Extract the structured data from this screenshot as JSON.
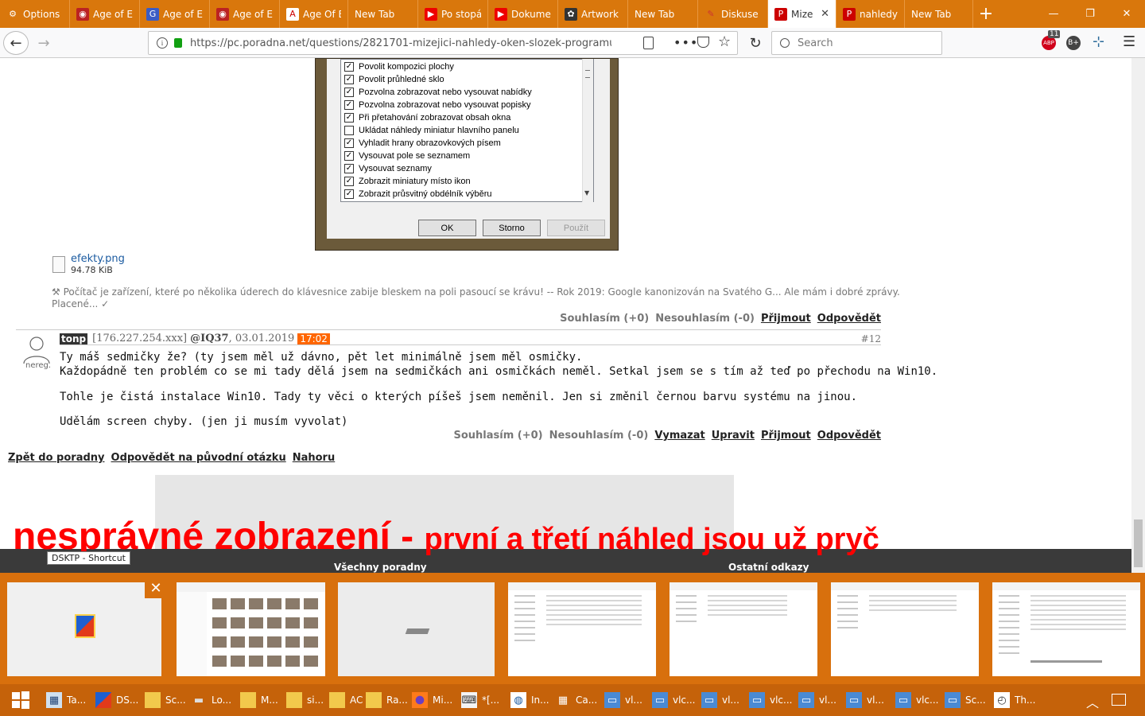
{
  "tabs": [
    {
      "label": "Options",
      "icon": "gear-icon",
      "active": false
    },
    {
      "label": "Age of E",
      "icon": "aoe-icon",
      "active": false
    },
    {
      "label": "Age of E",
      "icon": "g-icon",
      "active": false
    },
    {
      "label": "Age of E",
      "icon": "aoe-icon",
      "active": false
    },
    {
      "label": "Age Of E",
      "icon": "a-icon",
      "active": false
    },
    {
      "label": "New Tab",
      "icon": "",
      "active": false
    },
    {
      "label": "Po stopá",
      "icon": "youtube-icon",
      "active": false
    },
    {
      "label": "Dokume",
      "icon": "youtube-icon",
      "active": false
    },
    {
      "label": "Artwork",
      "icon": "paw-icon",
      "active": false
    },
    {
      "label": "New Tab",
      "icon": "",
      "active": false
    },
    {
      "label": "Diskuse",
      "icon": "pen-icon",
      "active": false
    },
    {
      "label": "Mize",
      "icon": "pnet-icon",
      "active": true
    },
    {
      "label": "nahledy",
      "icon": "pnet-icon",
      "active": false
    },
    {
      "label": "New Tab",
      "icon": "",
      "active": false
    }
  ],
  "nav": {
    "url": "https://pc.poradna.net/questions/2821701-mizejici-nahledy-oken-slozek-programu-ob",
    "search_placeholder": "Search",
    "badge_count": "11"
  },
  "dialog": {
    "items": [
      {
        "label": "Povolit kompozici plochy",
        "checked": true
      },
      {
        "label": "Povolit průhledné sklo",
        "checked": true
      },
      {
        "label": "Pozvolna zobrazovat nebo vysouvat nabídky",
        "checked": true
      },
      {
        "label": "Pozvolna zobrazovat nebo vysouvat popisky",
        "checked": true
      },
      {
        "label": "Při přetahování zobrazovat obsah okna",
        "checked": true
      },
      {
        "label": "Ukládat náhledy miniatur hlavního panelu",
        "checked": false
      },
      {
        "label": "Vyhladit hrany obrazovkových písem",
        "checked": true
      },
      {
        "label": "Vysouvat pole se seznamem",
        "checked": true
      },
      {
        "label": "Vysouvat seznamy",
        "checked": true
      },
      {
        "label": "Zobrazit miniatury místo ikon",
        "checked": true
      },
      {
        "label": "Zobrazit průsvitný obdélník výběru",
        "checked": true
      }
    ],
    "ok": "OK",
    "cancel": "Storno",
    "apply": "Použít"
  },
  "attachment": {
    "name": "efekty.png",
    "size": "94.78 KiB"
  },
  "signature": {
    "line1": "⚒ Počítač je zařízení, které po několika úderech do klávesnice zabije bleskem na poli pasoucí se krávu! -- Rok 2019: Google kanonizován na Svatého G... Ale mám i dobré zprávy.",
    "line2": "Placené... ✓"
  },
  "post1_actions": {
    "agree": "Souhlasím (+0)",
    "disagree": "Nesouhlasím (-0)",
    "accept": "Přijmout",
    "reply": "Odpovědět"
  },
  "post2": {
    "author": "tonp",
    "ip": "[176.227.254.xxx]",
    "to": "@IQ37",
    "date": ", 03.01.2019",
    "time": "17:02",
    "number": "#12",
    "avatar_label": "nereg.",
    "lines": [
      "Ty máš sedmičky že? (ty jsem měl už dávno, pět let minimálně jsem měl osmičky.",
      "Každopádně ten problém co se mi tady dělá jsem na sedmičkách ani osmičkách neměl. Setkal jsem se s tím až teď po přechodu na Win10.",
      "Tohle je čistá instalace Win10. Tady ty věci o kterých píšeš jsem neměnil. Jen si změnil černou barvu systému na jinou.",
      "Udělám screen chyby. (jen ji musím vyvolat)"
    ],
    "actions": {
      "agree": "Souhlasím (+0)",
      "disagree": "Nesouhlasím (-0)",
      "delete": "Vymazat",
      "edit": "Upravit",
      "accept": "Přijmout",
      "reply": "Odpovědět"
    }
  },
  "bottom_links": [
    "Zpět do poradny",
    "Odpovědět na původní otázku",
    "Nahoru"
  ],
  "footer": {
    "col1": "Všechny poradny",
    "col2": "Ostatní odkazy"
  },
  "annotation": {
    "big": "nesprávné zobrazení - ",
    "small": "první a třetí náhled jsou už pryč"
  },
  "tooltip": "DSKTP - Shortcut",
  "taskbar": [
    {
      "label": "Ta...",
      "icon": "taskmgr-icon"
    },
    {
      "label": "DS...",
      "icon": "dsktp-icon"
    },
    {
      "label": "Sc...",
      "icon": "folder-icon"
    },
    {
      "label": "Lo...",
      "icon": "drive-icon"
    },
    {
      "label": "M...",
      "icon": "folder-blue-icon"
    },
    {
      "label": "si...",
      "icon": "folder-icon"
    },
    {
      "label": "AC",
      "icon": "folder-icon"
    },
    {
      "label": "Ra...",
      "icon": "folder-icon"
    },
    {
      "label": "Mi...",
      "icon": "firefox-icon"
    },
    {
      "label": "*[...",
      "icon": "keyboard-icon"
    },
    {
      "label": "In...",
      "icon": "browser-icon"
    },
    {
      "label": "Ca...",
      "icon": "calculator-icon"
    },
    {
      "label": "vl...",
      "icon": "vlc-window-icon"
    },
    {
      "label": "vlc...",
      "icon": "vlc-window-icon"
    },
    {
      "label": "vl...",
      "icon": "vlc-window-icon"
    },
    {
      "label": "vlc...",
      "icon": "vlc-window-icon"
    },
    {
      "label": "vl...",
      "icon": "vlc-window-icon"
    },
    {
      "label": "vl...",
      "icon": "vlc-window-icon"
    },
    {
      "label": "vlc...",
      "icon": "vlc-window-icon"
    },
    {
      "label": "Sc...",
      "icon": "vlc-window-icon"
    },
    {
      "label": "Th...",
      "icon": "clock-icon"
    }
  ]
}
